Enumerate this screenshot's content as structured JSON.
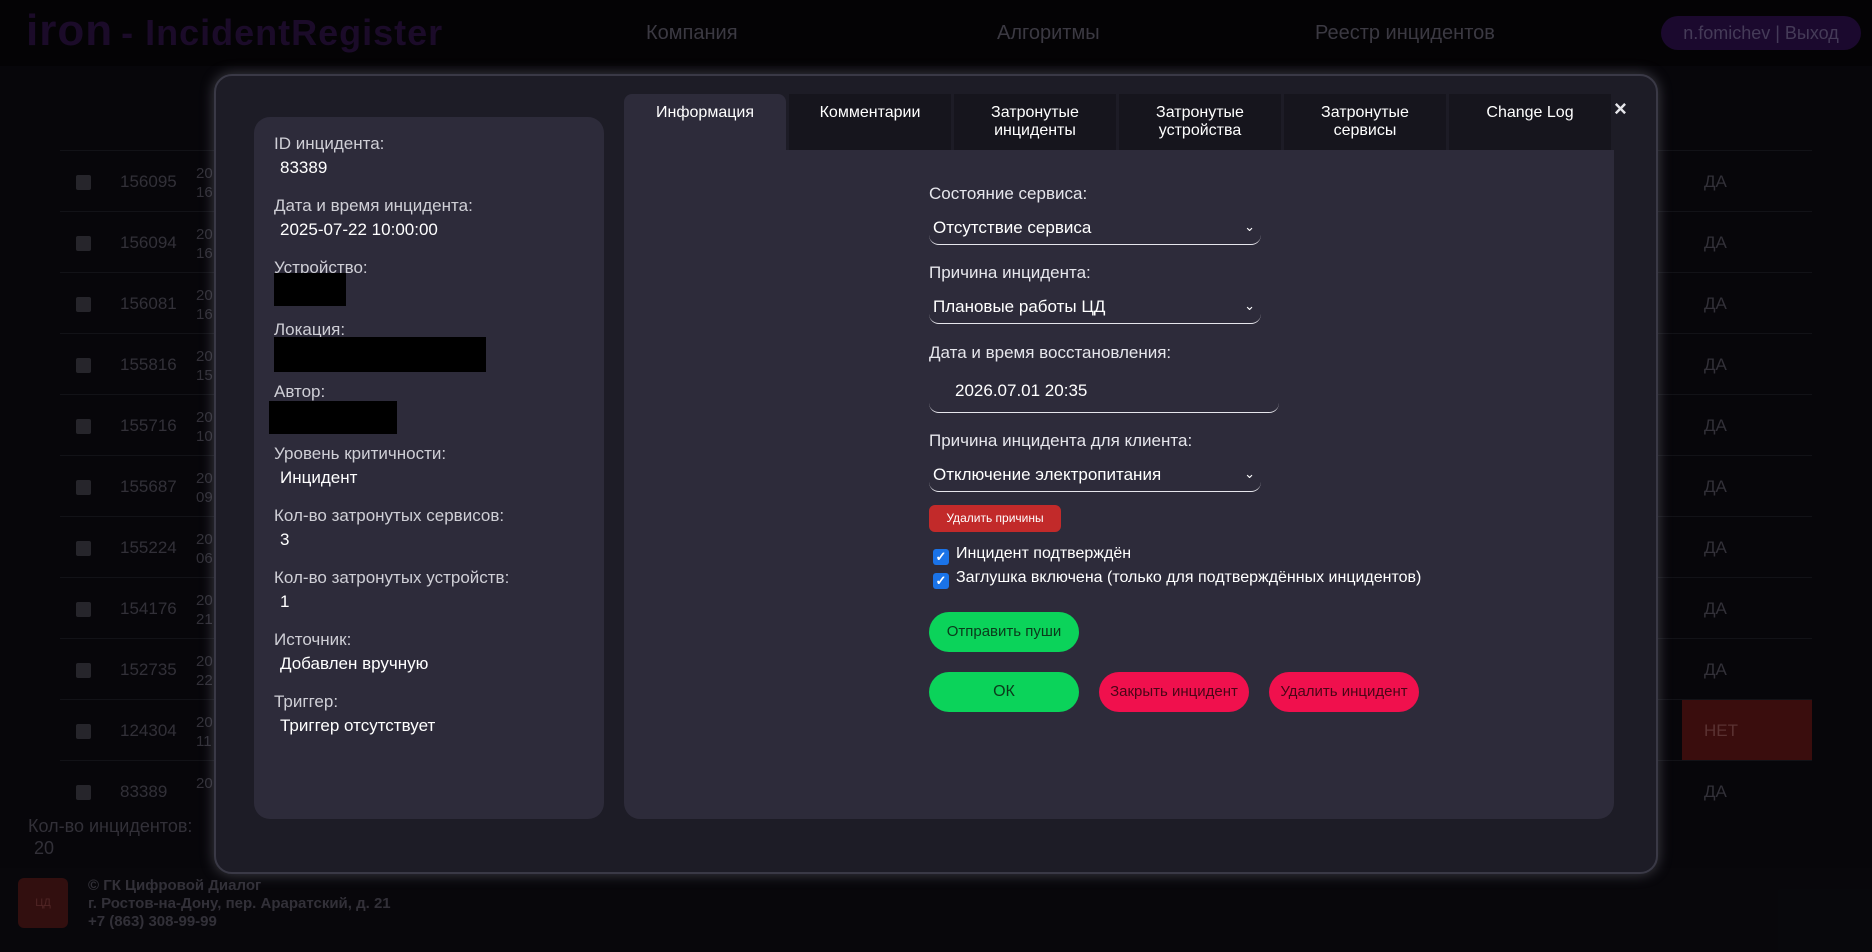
{
  "app": {
    "logo_main": "iron",
    "logo_sub": "- IncidentRegister"
  },
  "nav": {
    "items": [
      "Компания",
      "Алгоритмы",
      "Реестр инцидентов"
    ],
    "user": "n.fomichev | Выход"
  },
  "table": {
    "rows": [
      {
        "id": "156095",
        "date": "20 16",
        "confirmed": "ДА"
      },
      {
        "id": "156094",
        "date": "20 16",
        "confirmed": "ДА"
      },
      {
        "id": "156081",
        "date": "20 16",
        "confirmed": "ДА"
      },
      {
        "id": "155816",
        "date": "20 15",
        "confirmed": "ДА"
      },
      {
        "id": "155716",
        "date": "20 10",
        "confirmed": "ДА"
      },
      {
        "id": "155687",
        "date": "20 09",
        "confirmed": "ДА"
      },
      {
        "id": "155224",
        "date": "20 06",
        "confirmed": "ДА"
      },
      {
        "id": "154176",
        "date": "20 21",
        "confirmed": "ДА"
      },
      {
        "id": "152735",
        "date": "20 22",
        "confirmed": "ДА"
      },
      {
        "id": "124304",
        "date": "20 11",
        "confirmed": "НЕТ"
      },
      {
        "id": "83389",
        "date": "20",
        "confirmed": "ДА"
      }
    ],
    "count_label": "Кол-во инцидентов:",
    "count_value": "20"
  },
  "footer": {
    "logo_text": "ЦД",
    "line1": "© ГК Цифровой Диалог",
    "line2": "г. Ростов-на-Дону, пер. Араратский, д. 21",
    "line3": "+7 (863) 308-99-99"
  },
  "modal": {
    "close": "×",
    "info": {
      "id_label": "ID инцидента:",
      "id_value": "83389",
      "datetime_label": "Дата и время инцидента:",
      "datetime_value": "2025-07-22 10:00:00",
      "device_label": "Устройство:",
      "location_label": "Локация:",
      "author_label": "Автор:",
      "severity_label": "Уровень критичности:",
      "severity_value": "Инцидент",
      "services_label": "Кол-во затронутых сервисов:",
      "services_value": "3",
      "devices_label": "Кол-во затронутых устройств:",
      "devices_value": "1",
      "source_label": "Источник:",
      "source_value": "Добавлен вручную",
      "trigger_label": "Триггер:",
      "trigger_value": "Триггер отсутствует"
    },
    "tabs": [
      "Информация",
      "Комментарии",
      "Затронутые\nинциденты",
      "Затронутые\nустройства",
      "Затронутые\nсервисы",
      "Change Log"
    ],
    "form": {
      "service_state_label": "Состояние сервиса:",
      "service_state_value": "Отсутствие сервиса",
      "reason_label": "Причина инцидента:",
      "reason_value": "Плановые работы ЦД",
      "restore_label": "Дата и время восстановления:",
      "restore_value": "2026.07.01 20:35",
      "client_reason_label": "Причина инцидента для клиента:",
      "client_reason_value": "Отключение электропитания",
      "delete_reasons": "Удалить причины",
      "confirmed_label": "Инцидент подтверждён",
      "stub_label": "Заглушка включена (только для подтверждённых инцидентов)",
      "push_button": "Отправить пуши",
      "ok_button": "ОК",
      "close_button": "Закрыть инцидент",
      "delete_button": "Удалить инцидент"
    }
  }
}
